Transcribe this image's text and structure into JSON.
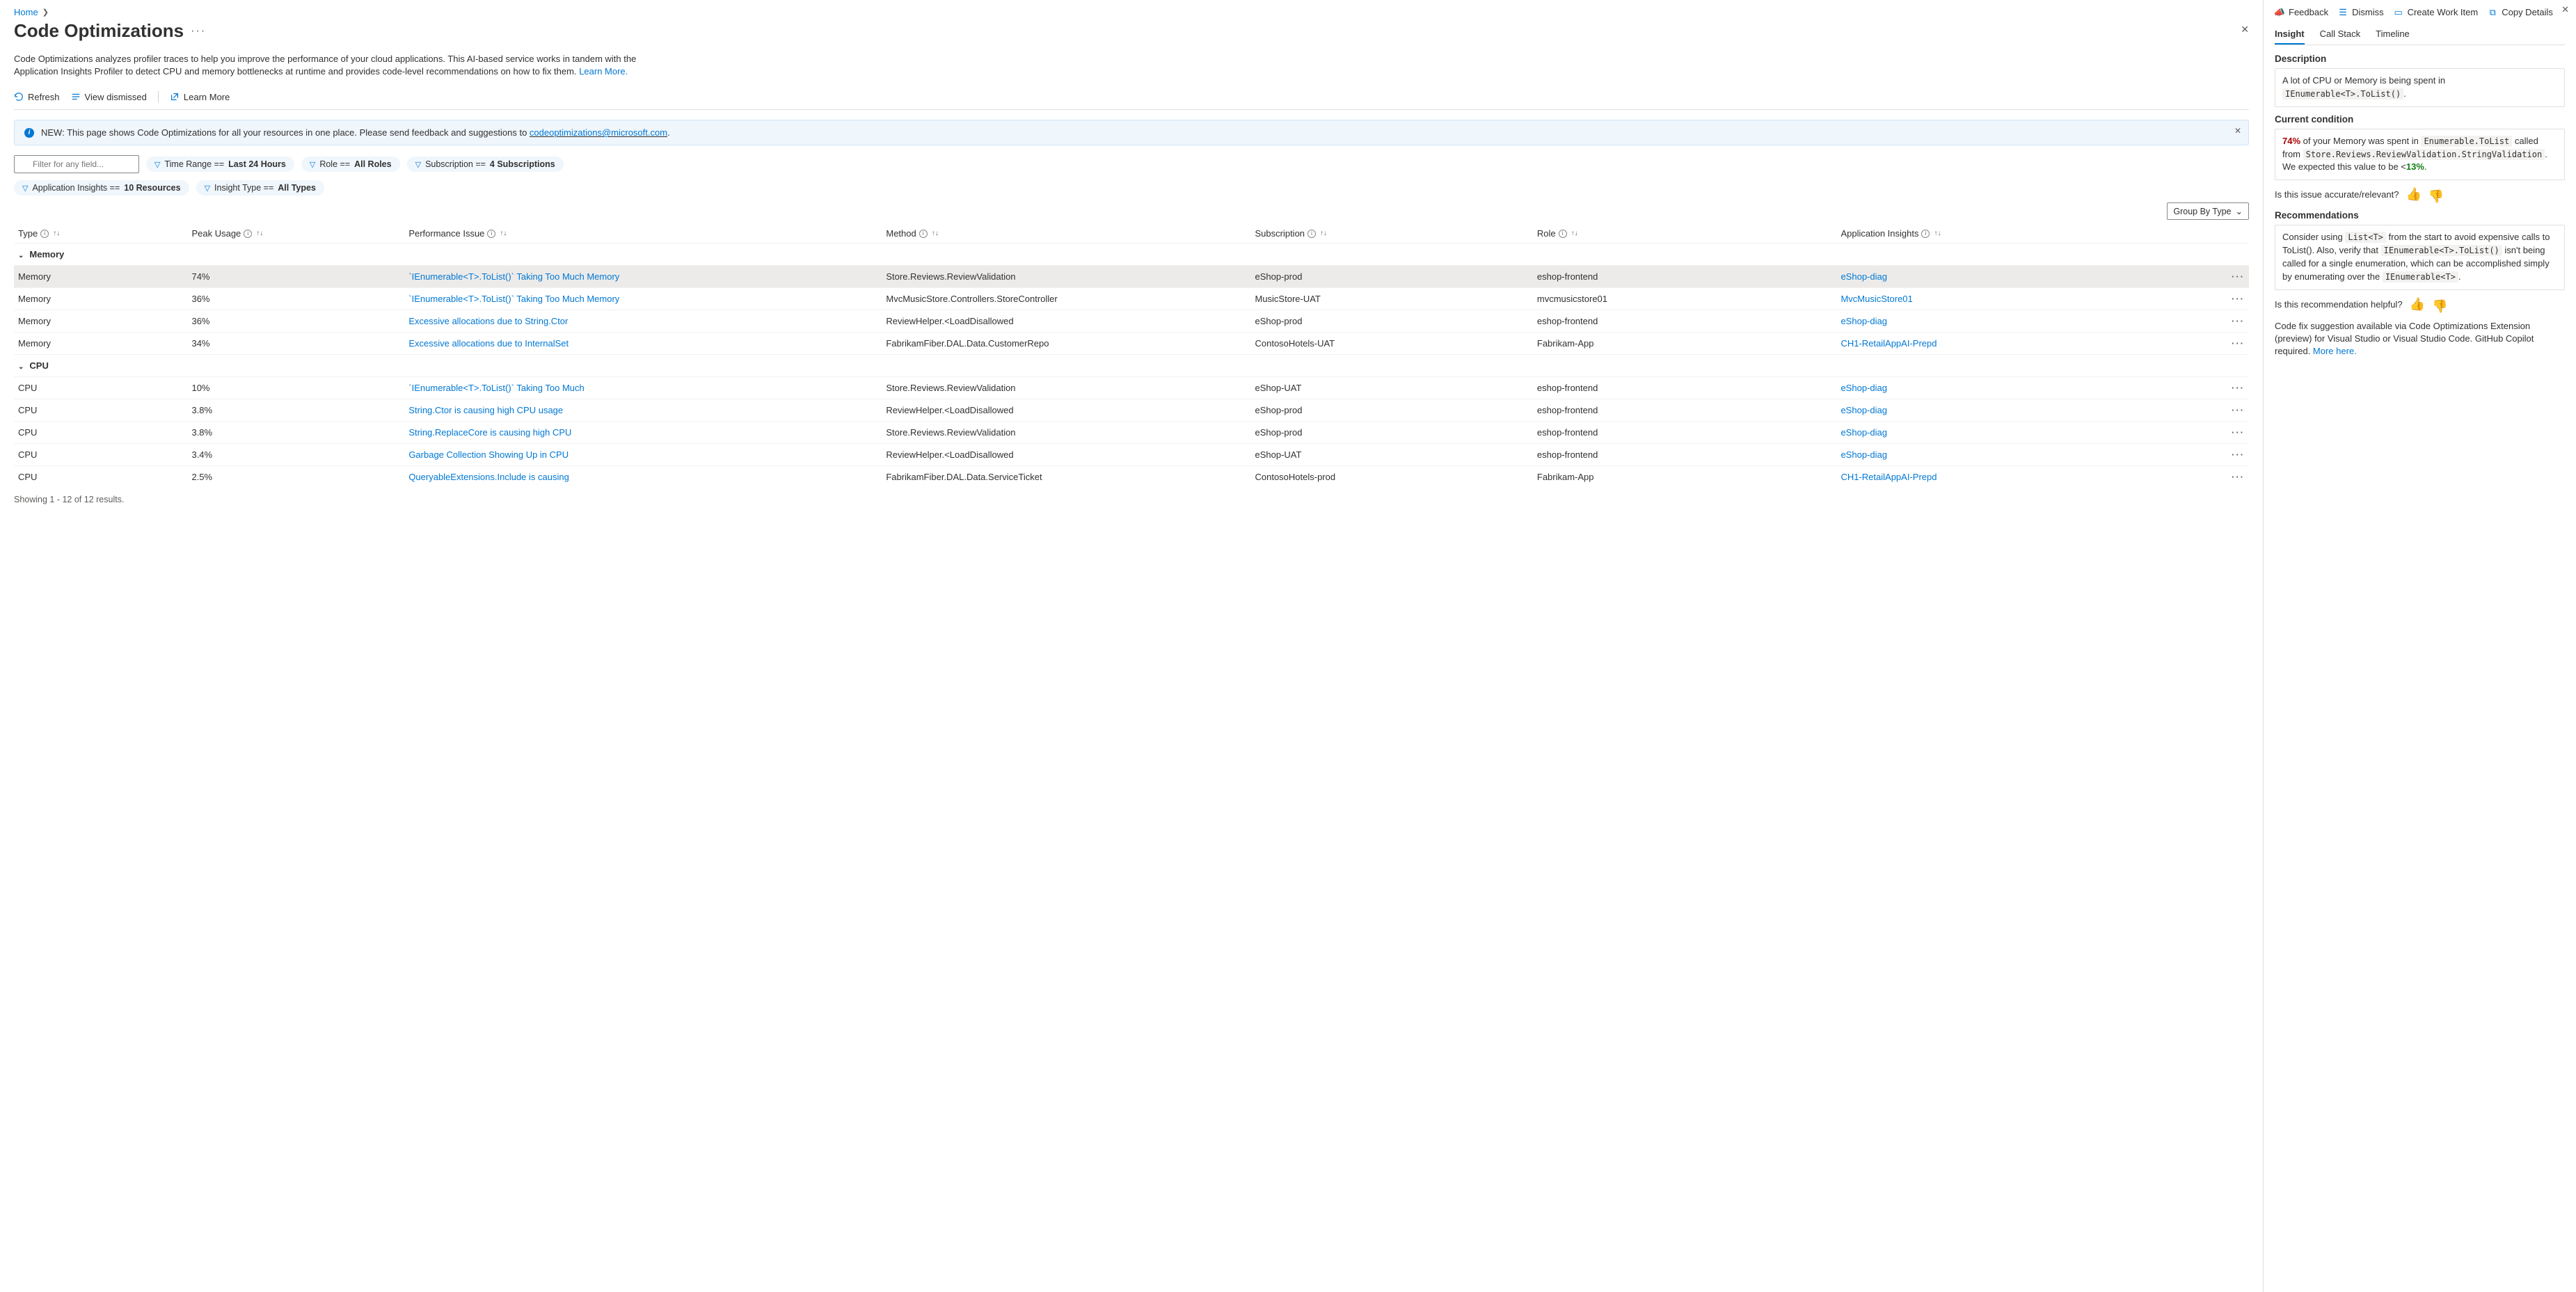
{
  "breadcrumb": {
    "home": "Home"
  },
  "page": {
    "title": "Code Optimizations",
    "description_1": "Code Optimizations analyzes profiler traces to help you improve the performance of your cloud applications. This AI-based service works in tandem with the Application Insights Profiler to detect CPU and memory bottlenecks at runtime and provides code-level recommendations on how to fix them. ",
    "learn_more": "Learn More."
  },
  "toolbar": {
    "refresh": "Refresh",
    "view_dismissed": "View dismissed",
    "learn_more": "Learn More"
  },
  "banner": {
    "prefix": "NEW: This page shows Code Optimizations for all your resources in one place. Please send feedback and suggestions to ",
    "email": "codeoptimizations@microsoft.com",
    "suffix": "."
  },
  "filters": {
    "placeholder": "Filter for any field...",
    "time_range_label": "Time Range == ",
    "time_range_value": "Last 24 Hours",
    "role_label": "Role == ",
    "role_value": "All Roles",
    "subscription_label": "Subscription == ",
    "subscription_value": "4 Subscriptions",
    "ai_label": "Application Insights == ",
    "ai_value": "10 Resources",
    "type_label": "Insight Type == ",
    "type_value": "All Types",
    "group_by": "Group By Type"
  },
  "columns": {
    "type": "Type",
    "peak": "Peak Usage",
    "issue": "Performance Issue",
    "method": "Method",
    "subscription": "Subscription",
    "role": "Role",
    "ai": "Application Insights"
  },
  "groups": {
    "memory": "Memory",
    "cpu": "CPU"
  },
  "rows": {
    "m0": {
      "type": "Memory",
      "peak": "74%",
      "issue": "`IEnumerable<T>.ToList()` Taking Too Much Memory",
      "method": "Store.Reviews.ReviewValidation",
      "sub": "eShop-prod",
      "role": "eshop-frontend",
      "ai": "eShop-diag"
    },
    "m1": {
      "type": "Memory",
      "peak": "36%",
      "issue": "`IEnumerable<T>.ToList()` Taking Too Much Memory",
      "method": "MvcMusicStore.Controllers.StoreController",
      "sub": "MusicStore-UAT",
      "role": "mvcmusicstore01",
      "ai": "MvcMusicStore01"
    },
    "m2": {
      "type": "Memory",
      "peak": "36%",
      "issue": "Excessive allocations due to String.Ctor",
      "method": "ReviewHelper.<LoadDisallowed",
      "sub": "eShop-prod",
      "role": "eshop-frontend",
      "ai": "eShop-diag"
    },
    "m3": {
      "type": "Memory",
      "peak": "34%",
      "issue": "Excessive allocations due to InternalSet",
      "method": "FabrikamFiber.DAL.Data.CustomerRepo",
      "sub": "ContosoHotels-UAT",
      "role": "Fabrikam-App",
      "ai": "CH1-RetailAppAI-Prepd"
    },
    "c0": {
      "type": "CPU",
      "peak": "10%",
      "issue": "`IEnumerable<T>.ToList()` Taking Too Much",
      "method": "Store.Reviews.ReviewValidation",
      "sub": "eShop-UAT",
      "role": "eshop-frontend",
      "ai": "eShop-diag"
    },
    "c1": {
      "type": "CPU",
      "peak": "3.8%",
      "issue": "String.Ctor is causing high CPU usage",
      "method": "ReviewHelper.<LoadDisallowed",
      "sub": "eShop-prod",
      "role": "eshop-frontend",
      "ai": "eShop-diag"
    },
    "c2": {
      "type": "CPU",
      "peak": "3.8%",
      "issue": "String.ReplaceCore is causing high CPU",
      "method": "Store.Reviews.ReviewValidation",
      "sub": "eShop-prod",
      "role": "eshop-frontend",
      "ai": "eShop-diag"
    },
    "c3": {
      "type": "CPU",
      "peak": "3.4%",
      "issue": "Garbage Collection Showing Up in CPU",
      "method": "ReviewHelper.<LoadDisallowed",
      "sub": "eShop-UAT",
      "role": "eshop-frontend",
      "ai": "eShop-diag"
    },
    "c4": {
      "type": "CPU",
      "peak": "2.5%",
      "issue": "QueryableExtensions.Include is causing",
      "method": "FabrikamFiber.DAL.Data.ServiceTicket",
      "sub": "ContosoHotels-prod",
      "role": "Fabrikam-App",
      "ai": "CH1-RetailAppAI-Prepd"
    }
  },
  "footer": {
    "results": "Showing 1 - 12 of 12 results."
  },
  "side_panel": {
    "toolbar": {
      "feedback": "Feedback",
      "dismiss": "Dismiss",
      "create_work_item": "Create Work Item",
      "copy_details": "Copy Details"
    },
    "tabs": {
      "insight": "Insight",
      "call_stack": "Call Stack",
      "timeline": "Timeline"
    },
    "desc_title": "Description",
    "desc_text": "A lot of CPU or Memory is being spent in ",
    "desc_code": "IEnumerable<T>.ToList()",
    "desc_suffix": ".",
    "cond_title": "Current condition",
    "cond_pct": "74%",
    "cond_text1": " of your Memory was spent in ",
    "cond_code1": "Enumerable.ToList",
    "cond_text2": " called from ",
    "cond_code2": "Store.Reviews.ReviewValidation.StringValidation",
    "cond_text3": ". We expected this value to be <",
    "cond_pct2": "13%",
    "cond_text4": ".",
    "accurate_q": "Is this issue accurate/relevant?",
    "rec_title": "Recommendations",
    "rec_text1": "Consider using ",
    "rec_code1": "List<T>",
    "rec_text2": " from the start to avoid expensive calls to ToList(). Also, verify that ",
    "rec_code2": "IEnumerable<T>.ToList()",
    "rec_text3": " isn't being called for a single enumeration, which can be accomplished simply by enumerating over the ",
    "rec_code3": "IEnumerable<T>",
    "rec_text4": ".",
    "helpful_q": "Is this recommendation helpful?",
    "note_text": "Code fix suggestion available via Code Optimizations Extension (preview) for Visual Studio or Visual Studio Code. GitHub Copilot required. ",
    "note_link": "More here."
  }
}
